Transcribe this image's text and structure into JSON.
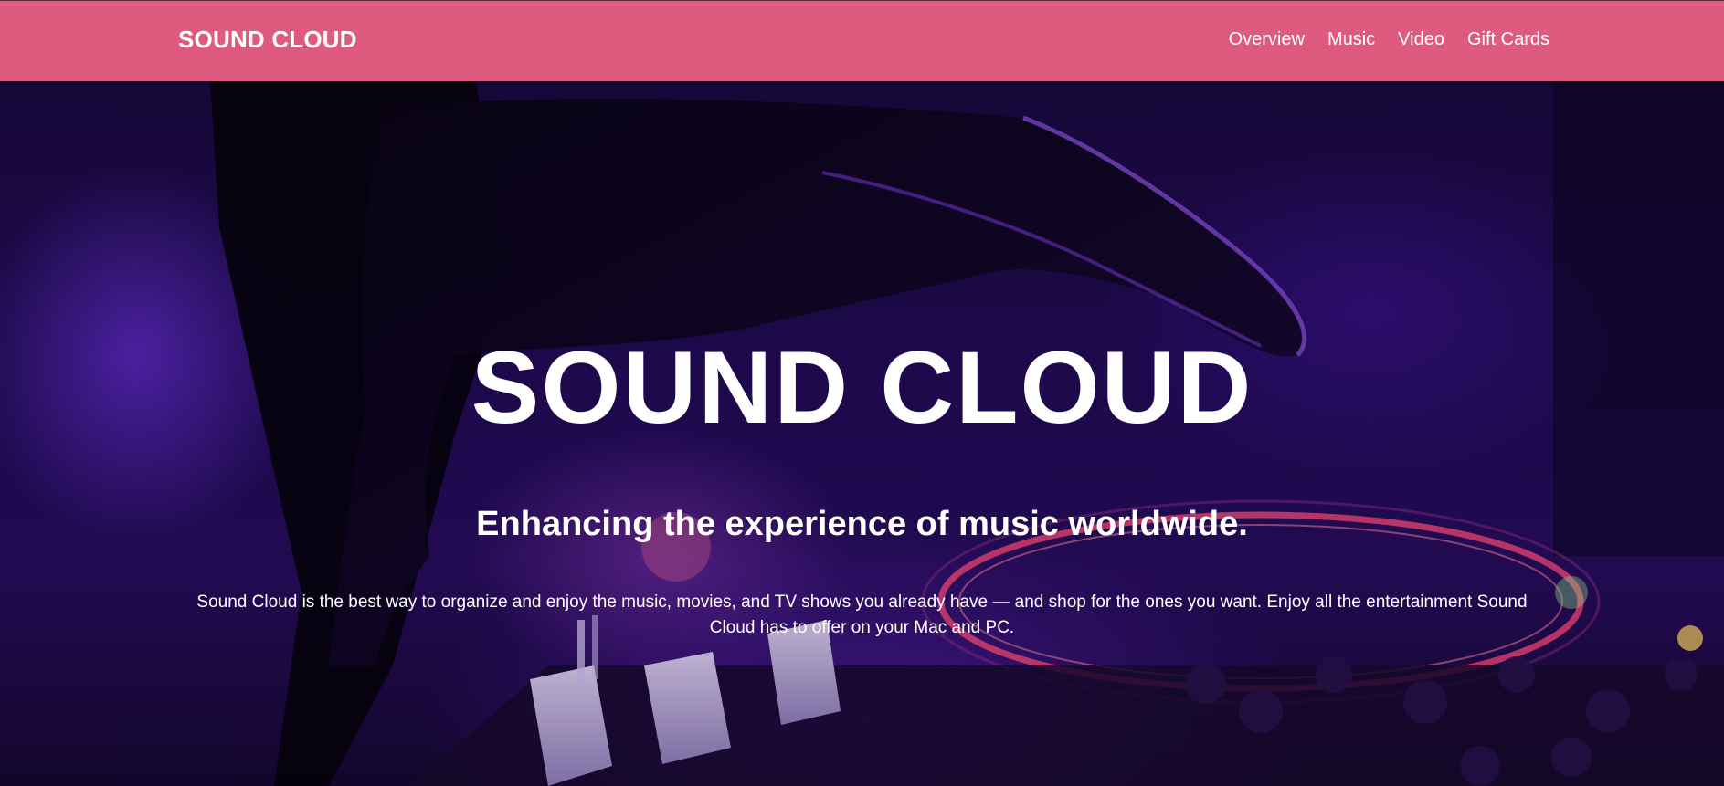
{
  "navbar": {
    "brand": "SOUND CLOUD",
    "links": [
      "Overview",
      "Music",
      "Video",
      "Gift Cards"
    ],
    "background_color": "#de5b7f"
  },
  "hero": {
    "title": "SOUND CLOUD",
    "subtitle": "Enhancing the experience of music worldwide.",
    "description": "Sound Cloud is the best way to organize and enjoy the music, movies, and TV shows you already have — and shop for the ones you want. Enjoy all the entertainment Sound Cloud has to offer on your Mac and PC.",
    "background_image": "dj-mixer-purple-photo",
    "text_color": "#ffffff"
  }
}
